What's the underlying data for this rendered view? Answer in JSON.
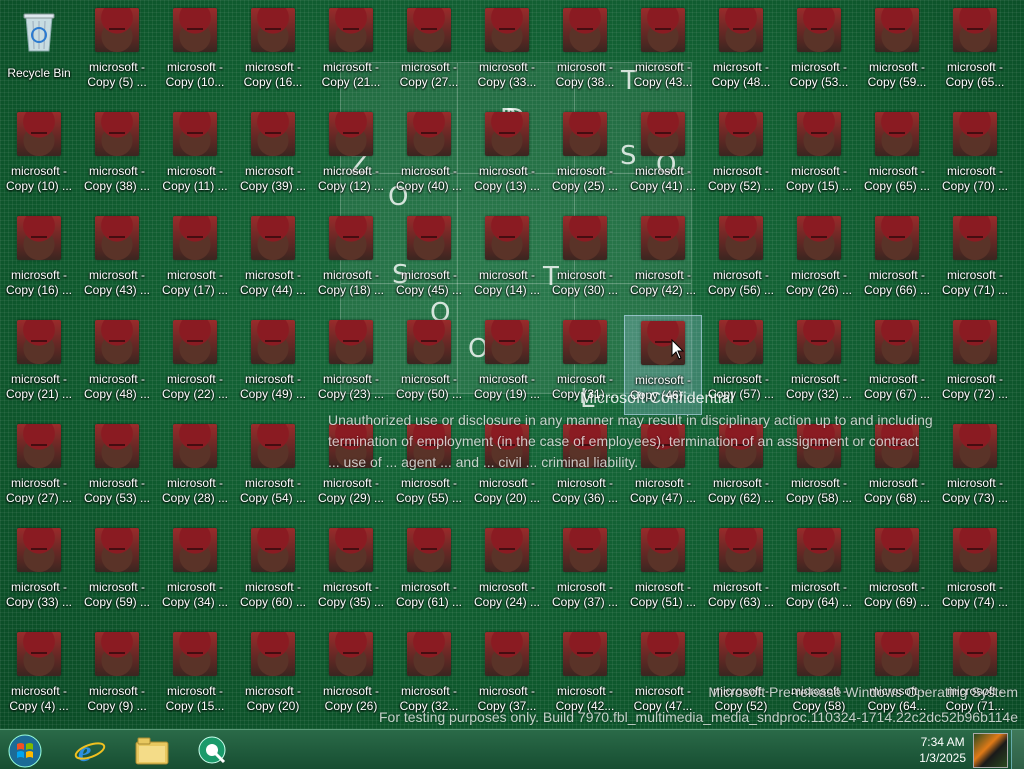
{
  "desktop": {
    "recycle_bin_label": "Recycle Bin",
    "icon_rows": [
      [
        "microsoft - Copy (5) ...",
        "microsoft - Copy (10...",
        "microsoft - Copy (16...",
        "microsoft - Copy (21...",
        "microsoft - Copy (27...",
        "microsoft - Copy (33...",
        "microsoft - Copy (38...",
        "microsoft - Copy (43...",
        "microsoft - Copy (48...",
        "microsoft - Copy (53...",
        "microsoft - Copy (59...",
        "microsoft - Copy (65..."
      ],
      [
        "microsoft - Copy (10) ...",
        "microsoft - Copy (38) ...",
        "microsoft - Copy (11) ...",
        "microsoft - Copy (39) ...",
        "microsoft - Copy (12) ...",
        "microsoft - Copy (40) ...",
        "microsoft - Copy (13) ...",
        "microsoft - Copy (25) ...",
        "microsoft - Copy (41) ...",
        "microsoft - Copy (52) ...",
        "microsoft - Copy (15) ...",
        "microsoft - Copy (65) ...",
        "microsoft - Copy (70) ..."
      ],
      [
        "microsoft - Copy (16) ...",
        "microsoft - Copy (43) ...",
        "microsoft - Copy (17) ...",
        "microsoft - Copy (44) ...",
        "microsoft - Copy (18) ...",
        "microsoft - Copy (45) ...",
        "microsoft - Copy (14) ...",
        "microsoft - Copy (30) ...",
        "microsoft - Copy (42) ...",
        "microsoft - Copy (56) ...",
        "microsoft - Copy (26) ...",
        "microsoft - Copy (66) ...",
        "microsoft - Copy (71) ..."
      ],
      [
        "microsoft - Copy (21) ...",
        "microsoft - Copy (48) ...",
        "microsoft - Copy (22) ...",
        "microsoft - Copy (49) ...",
        "microsoft - Copy (23) ...",
        "microsoft - Copy (50) ...",
        "microsoft - Copy (19) ...",
        "microsoft - Copy (31) ...",
        "microsoft - Copy (46) ...",
        "microsoft - Copy (57) ...",
        "microsoft - Copy (32) ...",
        "microsoft - Copy (67) ...",
        "microsoft - Copy (72) ..."
      ],
      [
        "microsoft - Copy (27) ...",
        "microsoft - Copy (53) ...",
        "microsoft - Copy (28) ...",
        "microsoft - Copy (54) ...",
        "microsoft - Copy (29) ...",
        "microsoft - Copy (55) ...",
        "microsoft - Copy (20) ...",
        "microsoft - Copy (36) ...",
        "microsoft - Copy (47) ...",
        "microsoft - Copy (62) ...",
        "microsoft - Copy (58) ...",
        "microsoft - Copy (68) ...",
        "microsoft - Copy (73) ..."
      ],
      [
        "microsoft - Copy (33) ...",
        "microsoft - Copy (59) ...",
        "microsoft - Copy (34) ...",
        "microsoft - Copy (60) ...",
        "microsoft - Copy (35) ...",
        "microsoft - Copy (61) ...",
        "microsoft - Copy (24) ...",
        "microsoft - Copy (37) ...",
        "microsoft - Copy (51) ...",
        "microsoft - Copy (63) ...",
        "microsoft - Copy (64) ...",
        "microsoft - Copy (69) ...",
        "microsoft - Copy (74) ..."
      ],
      [
        "microsoft - Copy (4) ...",
        "microsoft - Copy (9) ...",
        "microsoft - Copy (15...",
        "microsoft - Copy (20)",
        "microsoft - Copy (26)",
        "microsoft - Copy (32...",
        "microsoft - Copy (37...",
        "microsoft - Copy (42...",
        "microsoft - Copy (47...",
        "microsoft - Copy (52)",
        "microsoft - Copy (58)",
        "microsoft - Copy (64...",
        "microsoft - Copy (71..."
      ]
    ],
    "selected_icon": "microsoft - Copy (46) ...",
    "watermark_letters": [
      "T",
      "D",
      "O",
      "S",
      "Z",
      "O",
      "S",
      "T",
      "O",
      "L",
      "O",
      "R"
    ],
    "confidential_title": "Microsoft Confidential",
    "confidential_lines": [
      "Unauthorized use or disclosure in any manner may result in disciplinary action up to and including",
      "termination of employment (in the case of employees), termination of an assignment or contract",
      "... use of ... agent ... and ... civil ... criminal liability."
    ],
    "build_line_1": "Microsoft Pre-release Windows Operating System",
    "build_line_2": "For testing purposes only. Build 7970.fbl_multimedia_media_sndproc.110324-1714.22c2dc52b96b114e"
  },
  "taskbar": {
    "start_button": "Start",
    "pinned": [
      "Internet Explorer",
      "Windows Explorer",
      "Windows Live"
    ],
    "clock_time": "7:34 AM",
    "clock_date": "1/3/2025",
    "colors": {
      "taskbar": "#1f5c3c",
      "desktop": "#0f5a2e"
    }
  }
}
